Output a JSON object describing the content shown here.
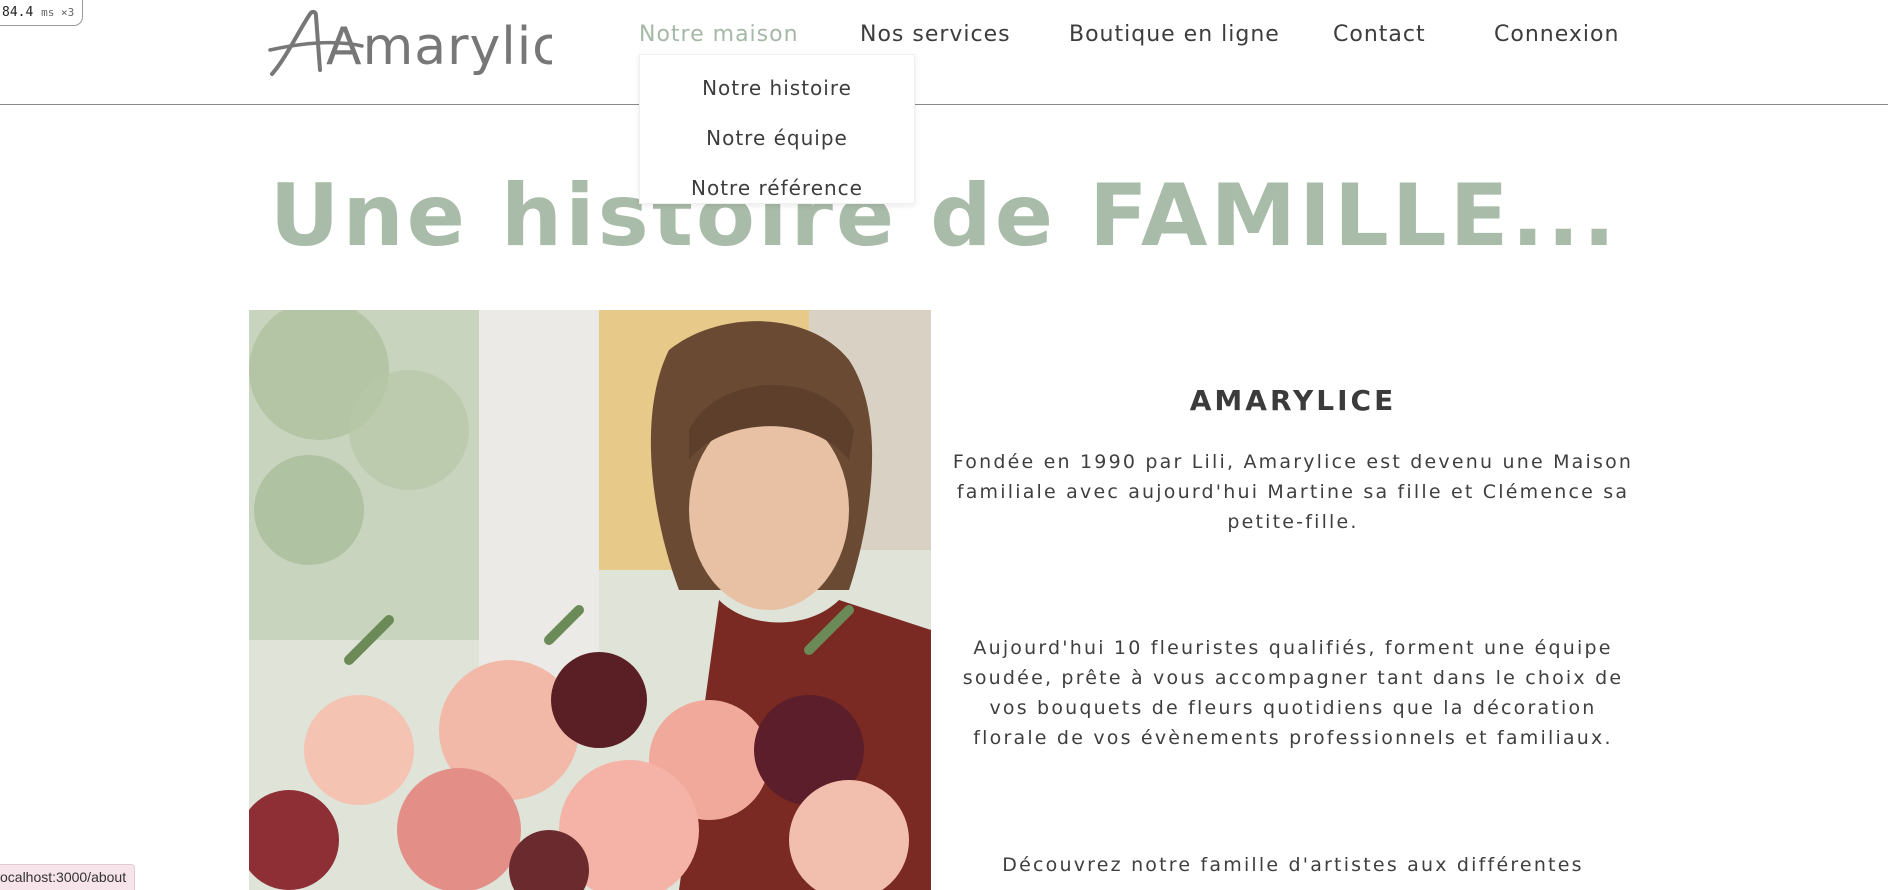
{
  "perf_badge": {
    "value": "84.4",
    "unit": "ms ×3"
  },
  "header": {
    "logo_text": "Amarylice",
    "nav": [
      {
        "label": "Notre maison",
        "active": true
      },
      {
        "label": "Nos services",
        "active": false
      },
      {
        "label": "Boutique en ligne",
        "active": false
      },
      {
        "label": "Contact",
        "active": false
      },
      {
        "label": "Connexion",
        "active": false
      }
    ],
    "dropdown": [
      {
        "label": "Notre histoire"
      },
      {
        "label": "Notre équipe"
      },
      {
        "label": "Notre référence"
      }
    ]
  },
  "hero": {
    "title": "Une histoire de FAMILLE..."
  },
  "about": {
    "heading": "AMARYLICE",
    "paragraphs": [
      "Fondée en 1990 par Lili, Amarylice est devenu une Maison familiale avec aujourd'hui Martine sa fille et Clémence sa petite-fille.",
      "Aujourd'hui 10 fleuristes qualifiés, forment une équipe soudée, prête à vous accompagner tant dans le choix de vos bouquets de fleurs quotidiens que la décoration florale de vos évènements professionnels et familiaux.",
      "Découvrez notre famille d'artistes aux différentes"
    ]
  },
  "status_bar": {
    "url": "ocalhost:3000/about"
  },
  "colors": {
    "accent": "#a9bba9",
    "text": "#3b3b3b",
    "status_bg": "#f6e4ea"
  }
}
